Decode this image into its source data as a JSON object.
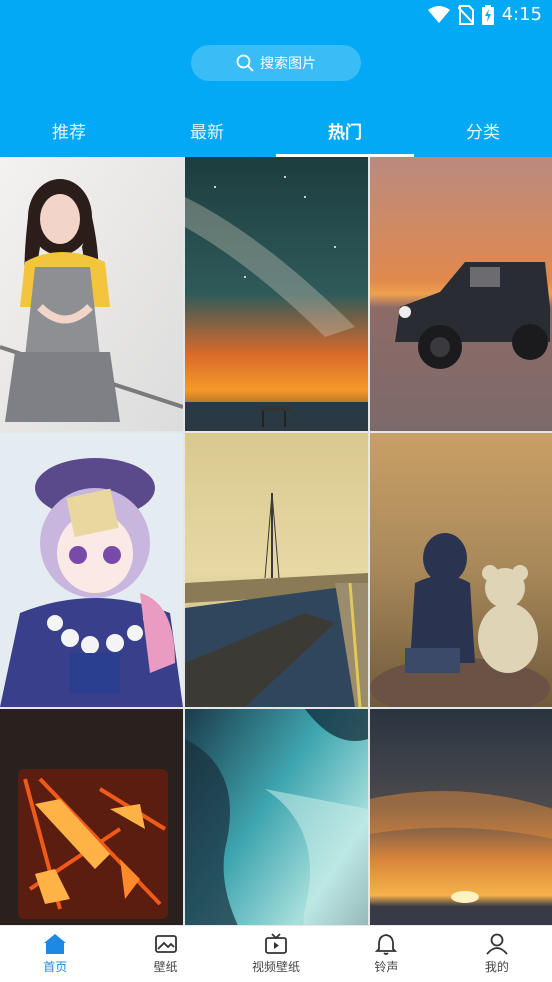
{
  "status": {
    "time": "4:15"
  },
  "search": {
    "placeholder": "搜索图片"
  },
  "tabs": [
    {
      "label": "推荐"
    },
    {
      "label": "最新"
    },
    {
      "label": "热门",
      "active": true
    },
    {
      "label": "分类"
    }
  ],
  "grid": {
    "items": [
      {
        "icon": "portrait-girl-wallpaper"
      },
      {
        "icon": "milky-way-sunset-wallpaper"
      },
      {
        "icon": "jeep-sunset-wallpaper"
      },
      {
        "icon": "anime-girl-wallpaper"
      },
      {
        "icon": "tower-river-wallpaper"
      },
      {
        "icon": "child-teddy-bear-wallpaper"
      },
      {
        "icon": "lava-logo-wallpaper"
      },
      {
        "icon": "teal-abstract-wallpaper"
      },
      {
        "icon": "ocean-sunset-wallpaper"
      }
    ]
  },
  "nav": {
    "items": [
      {
        "label": "首页",
        "icon": "home-icon",
        "active": true
      },
      {
        "label": "壁纸",
        "icon": "image-icon"
      },
      {
        "label": "视频壁纸",
        "icon": "video-icon"
      },
      {
        "label": "铃声",
        "icon": "bell-icon"
      },
      {
        "label": "我的",
        "icon": "user-icon"
      }
    ]
  },
  "colors": {
    "primary": "#03a9f4",
    "nav_active": "#1e88e5"
  }
}
